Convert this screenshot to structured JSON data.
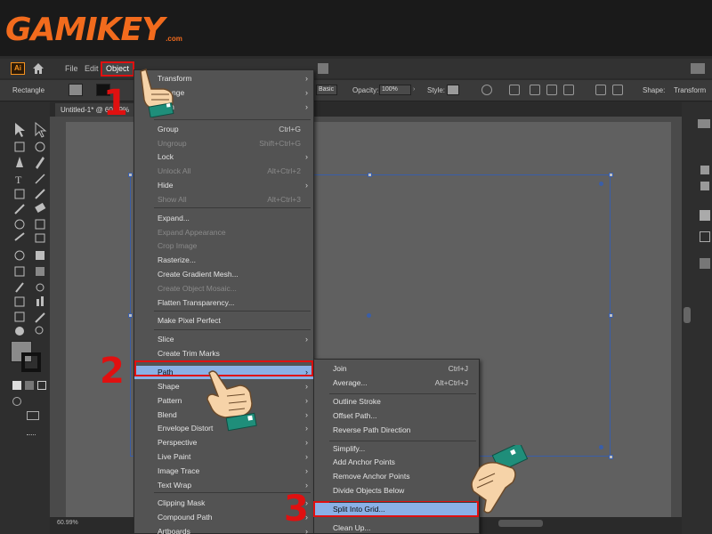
{
  "brand": {
    "name": "GAMIKEY",
    "domain": ".com"
  },
  "menubar": {
    "app_icon": "Ai",
    "items": [
      "File",
      "Edit",
      "Object"
    ]
  },
  "control_bar": {
    "object_type": "Rectangle",
    "style_basic": "Basic",
    "opacity_label": "Opacity:",
    "opacity_value": "100%",
    "style_label": "Style:",
    "shape_label": "Shape:",
    "transform_label": "Transform"
  },
  "doc_tab": {
    "title": "Untitled-1* @ 60.99%"
  },
  "status": {
    "zoom": "60.99%"
  },
  "object_menu": {
    "items": [
      {
        "label": "Transform",
        "shortcut": "",
        "submenu": true,
        "disabled": false
      },
      {
        "label": "Arrange",
        "shortcut": "",
        "submenu": true,
        "disabled": false
      },
      {
        "label": "Align",
        "shortcut": "",
        "submenu": true,
        "disabled": false
      },
      {
        "label": "Group",
        "shortcut": "Ctrl+G",
        "submenu": false,
        "disabled": false
      },
      {
        "label": "Ungroup",
        "shortcut": "Shift+Ctrl+G",
        "submenu": false,
        "disabled": true
      },
      {
        "label": "Lock",
        "shortcut": "",
        "submenu": true,
        "disabled": false
      },
      {
        "label": "Unlock All",
        "shortcut": "Alt+Ctrl+2",
        "submenu": false,
        "disabled": true
      },
      {
        "label": "Hide",
        "shortcut": "",
        "submenu": true,
        "disabled": false
      },
      {
        "label": "Show All",
        "shortcut": "Alt+Ctrl+3",
        "submenu": false,
        "disabled": true
      },
      {
        "label": "Expand...",
        "shortcut": "",
        "submenu": false,
        "disabled": false
      },
      {
        "label": "Expand Appearance",
        "shortcut": "",
        "submenu": false,
        "disabled": true
      },
      {
        "label": "Crop Image",
        "shortcut": "",
        "submenu": false,
        "disabled": true
      },
      {
        "label": "Rasterize...",
        "shortcut": "",
        "submenu": false,
        "disabled": false
      },
      {
        "label": "Create Gradient Mesh...",
        "shortcut": "",
        "submenu": false,
        "disabled": false
      },
      {
        "label": "Create Object Mosaic...",
        "shortcut": "",
        "submenu": false,
        "disabled": true
      },
      {
        "label": "Flatten Transparency...",
        "shortcut": "",
        "submenu": false,
        "disabled": false
      },
      {
        "label": "Make Pixel Perfect",
        "shortcut": "",
        "submenu": false,
        "disabled": false
      },
      {
        "label": "Slice",
        "shortcut": "",
        "submenu": true,
        "disabled": false
      },
      {
        "label": "Create Trim Marks",
        "shortcut": "",
        "submenu": false,
        "disabled": false
      },
      {
        "label": "Path",
        "shortcut": "",
        "submenu": true,
        "disabled": false
      },
      {
        "label": "Shape",
        "shortcut": "",
        "submenu": true,
        "disabled": false
      },
      {
        "label": "Pattern",
        "shortcut": "",
        "submenu": true,
        "disabled": false
      },
      {
        "label": "Blend",
        "shortcut": "",
        "submenu": true,
        "disabled": false
      },
      {
        "label": "Envelope Distort",
        "shortcut": "",
        "submenu": true,
        "disabled": false
      },
      {
        "label": "Perspective",
        "shortcut": "",
        "submenu": true,
        "disabled": false
      },
      {
        "label": "Live Paint",
        "shortcut": "",
        "submenu": true,
        "disabled": false
      },
      {
        "label": "Image Trace",
        "shortcut": "",
        "submenu": true,
        "disabled": false
      },
      {
        "label": "Text Wrap",
        "shortcut": "",
        "submenu": true,
        "disabled": false
      },
      {
        "label": "Clipping Mask",
        "shortcut": "",
        "submenu": true,
        "disabled": false
      },
      {
        "label": "Compound Path",
        "shortcut": "",
        "submenu": true,
        "disabled": false
      },
      {
        "label": "Artboards",
        "shortcut": "",
        "submenu": true,
        "disabled": false
      }
    ]
  },
  "path_submenu": {
    "items": [
      {
        "label": "Join",
        "shortcut": "Ctrl+J"
      },
      {
        "label": "Average...",
        "shortcut": "Alt+Ctrl+J"
      },
      {
        "label": "Outline Stroke",
        "shortcut": ""
      },
      {
        "label": "Offset Path...",
        "shortcut": ""
      },
      {
        "label": "Reverse Path Direction",
        "shortcut": ""
      },
      {
        "label": "Simplify...",
        "shortcut": ""
      },
      {
        "label": "Add Anchor Points",
        "shortcut": ""
      },
      {
        "label": "Remove Anchor Points",
        "shortcut": ""
      },
      {
        "label": "Divide Objects Below",
        "shortcut": ""
      },
      {
        "label": "Split Into Grid...",
        "shortcut": ""
      },
      {
        "label": "Clean Up...",
        "shortcut": ""
      }
    ]
  },
  "steps": [
    "1",
    "2",
    "3"
  ],
  "colors": {
    "accent_red": "#e01010",
    "highlight_blue": "#8ab0e6",
    "brand_orange": "#f26b1d"
  }
}
